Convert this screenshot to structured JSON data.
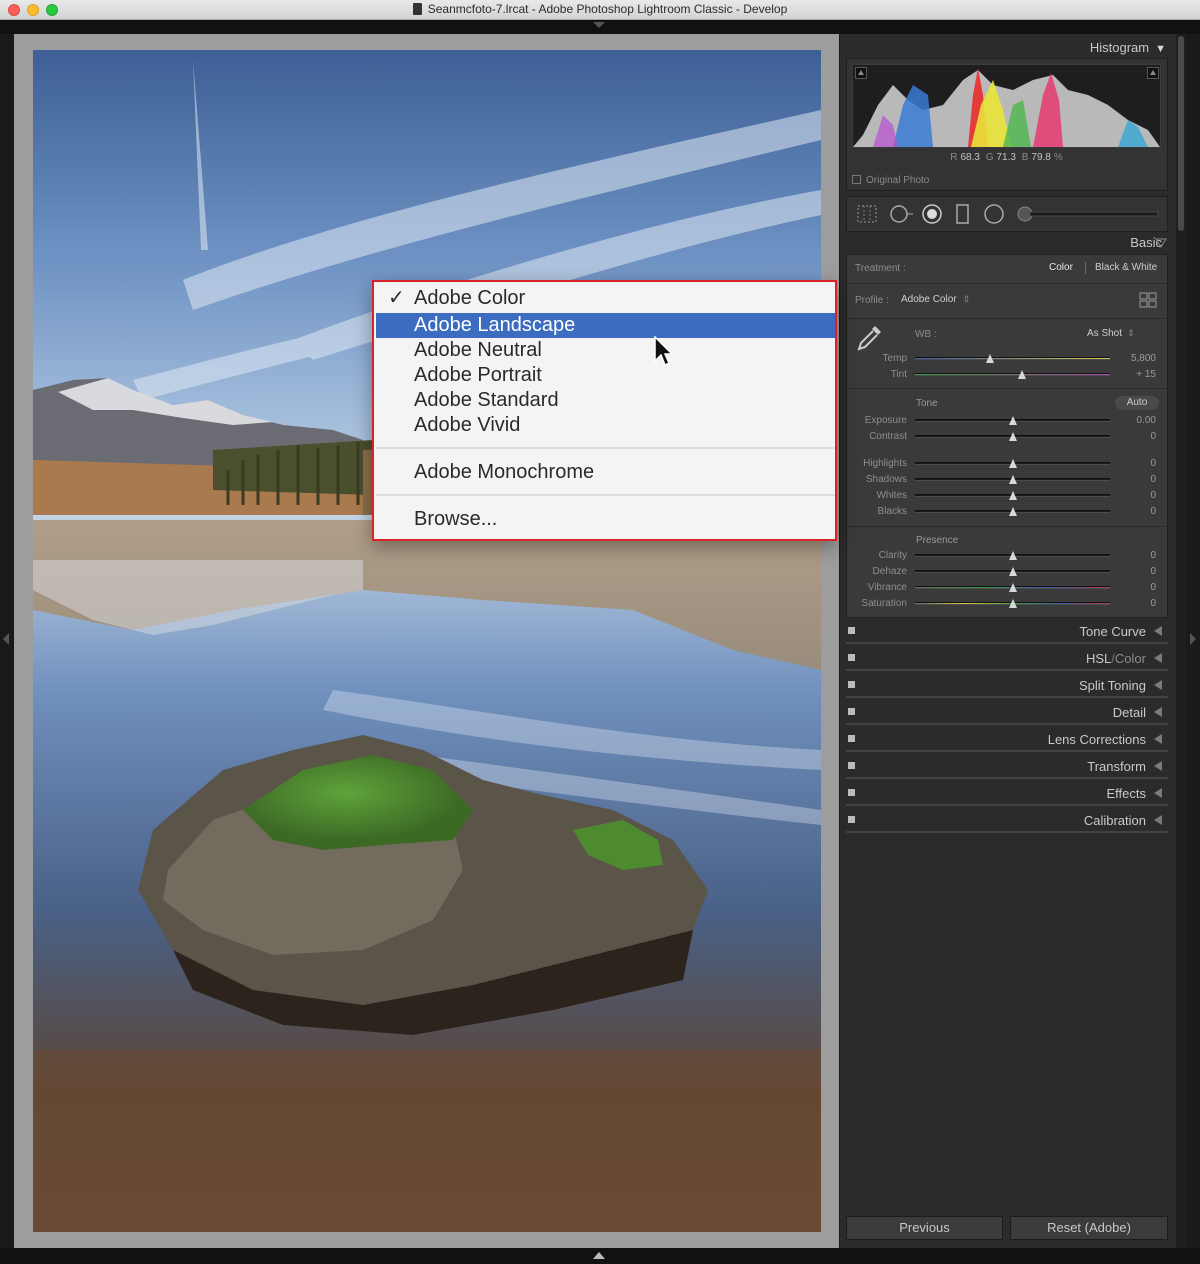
{
  "window": {
    "title": "Seanmcfoto-7.lrcat - Adobe Photoshop Lightroom Classic - Develop"
  },
  "histogram": {
    "header": "Histogram",
    "r_label": "R",
    "r_value": "68.3",
    "g_label": "G",
    "g_value": "71.3",
    "b_label": "B",
    "b_value": "79.8",
    "percent": "%",
    "original_photo_label": "Original Photo"
  },
  "basic": {
    "header": "Basic",
    "treatment_label": "Treatment :",
    "treatment_color": "Color",
    "treatment_bw": "Black & White",
    "profile_label": "Profile :",
    "profile_value": "Adobe Color",
    "wb_label": "WB :",
    "wb_value": "As Shot",
    "temp_label": "Temp",
    "temp_value": "5,800",
    "tint_label": "Tint",
    "tint_value": "+ 15",
    "tone_label": "Tone",
    "auto_label": "Auto",
    "exposure_label": "Exposure",
    "exposure_value": "0.00",
    "contrast_label": "Contrast",
    "contrast_value": "0",
    "highlights_label": "Highlights",
    "highlights_value": "0",
    "shadows_label": "Shadows",
    "shadows_value": "0",
    "whites_label": "Whites",
    "whites_value": "0",
    "blacks_label": "Blacks",
    "blacks_value": "0",
    "presence_label": "Presence",
    "clarity_label": "Clarity",
    "clarity_value": "0",
    "dehaze_label": "Dehaze",
    "dehaze_value": "0",
    "vibrance_label": "Vibrance",
    "vibrance_value": "0",
    "saturation_label": "Saturation",
    "saturation_value": "0"
  },
  "panels": {
    "tone_curve": "Tone Curve",
    "hsl": "HSL",
    "hsl_sep": "/",
    "color": "Color",
    "split_toning": "Split Toning",
    "detail": "Detail",
    "lens_corrections": "Lens Corrections",
    "transform": "Transform",
    "effects": "Effects",
    "calibration": "Calibration"
  },
  "buttons": {
    "previous": "Previous",
    "reset": "Reset (Adobe)"
  },
  "profile_menu": {
    "check": "✓",
    "items": [
      "Adobe Color",
      "Adobe Landscape",
      "Adobe Neutral",
      "Adobe Portrait",
      "Adobe Standard",
      "Adobe Vivid"
    ],
    "monochrome": "Adobe Monochrome",
    "browse": "Browse...",
    "checked_index": 0,
    "highlighted_index": 1
  },
  "colors": {
    "menu_highlight": "#3b6cc0",
    "menu_outline": "#d8232a",
    "panel_bg": "#2b2b2b"
  },
  "icons": [
    "document-icon",
    "crop-icon",
    "spot-removal-icon",
    "red-eye-icon",
    "graduated-filter-icon",
    "radial-filter-icon",
    "brush-icon",
    "eyedropper-icon",
    "profile-grid-icon",
    "cursor-arrow-icon"
  ]
}
